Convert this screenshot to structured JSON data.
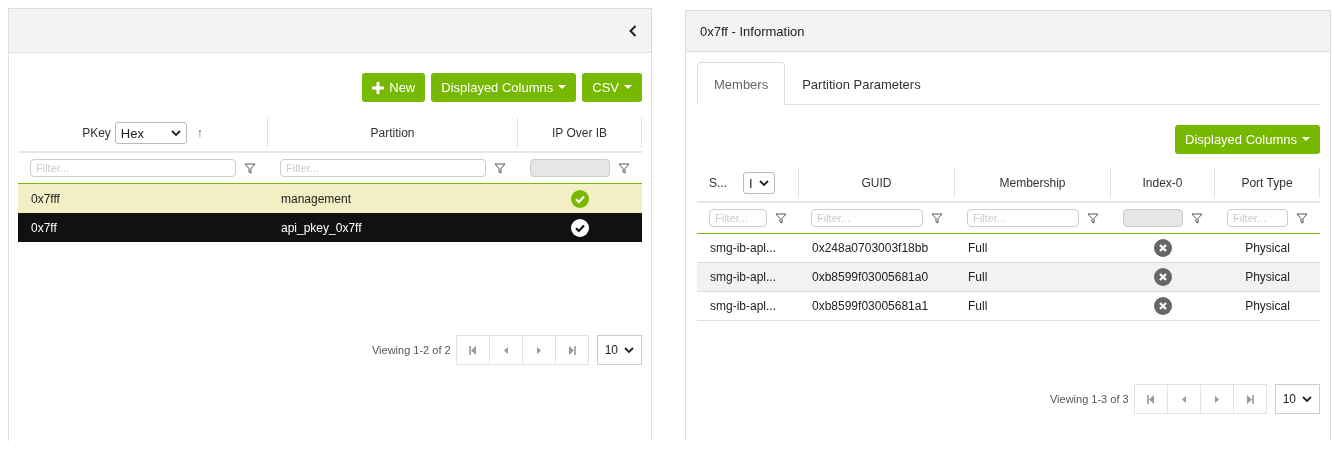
{
  "left_panel": {
    "toolbar": [
      {
        "kind": "new",
        "label": "New"
      },
      {
        "kind": "dropdown",
        "label": "Displayed Columns"
      },
      {
        "kind": "dropdown",
        "label": "CSV"
      }
    ],
    "table": {
      "columns": [
        {
          "label": "PKey",
          "select": "Hex",
          "sort": "↑",
          "filter": {
            "kind": "text",
            "placeholder": "Filter..."
          }
        },
        {
          "label": "Partition",
          "filter": {
            "kind": "text",
            "placeholder": "Filter..."
          }
        },
        {
          "label": "IP Over IB",
          "filter": {
            "kind": "select"
          }
        }
      ],
      "rows": [
        {
          "pkey": "0x7fff",
          "partition": "management",
          "ip_over_ib": true,
          "highlighted": true,
          "selected": false
        },
        {
          "pkey": "0x7ff",
          "partition": "api_pkey_0x7ff",
          "ip_over_ib": true,
          "highlighted": false,
          "selected": true
        }
      ]
    },
    "pagination": {
      "summary": "Viewing 1-2 of 2",
      "page_size": "10"
    }
  },
  "right_panel": {
    "title": "0x7ff - Information",
    "tabs": [
      {
        "label": "Members",
        "selected": true
      },
      {
        "label": "Partition Parameters",
        "selected": false
      }
    ],
    "toolbar": [
      {
        "kind": "dropdown",
        "label": "Displayed Columns"
      }
    ],
    "table": {
      "columns": [
        {
          "label": "S...",
          "select": "I",
          "filter": {
            "kind": "text",
            "placeholder": "Filter..."
          }
        },
        {
          "label": "GUID",
          "filter": {
            "kind": "text",
            "placeholder": "Filter..."
          }
        },
        {
          "label": "Membership",
          "filter": {
            "kind": "text",
            "placeholder": "Filter..."
          }
        },
        {
          "label": "Index-0",
          "filter": {
            "kind": "select"
          }
        },
        {
          "label": "Port Type",
          "filter": {
            "kind": "text",
            "placeholder": "Filter..."
          }
        }
      ],
      "rows": [
        {
          "system": "smg-ib-apl...",
          "guid": "0x248a0703003f18bb",
          "membership": "Full",
          "index_0": false,
          "port_type": "Physical"
        },
        {
          "system": "smg-ib-apl...",
          "guid": "0xb8599f03005681a0",
          "membership": "Full",
          "index_0": false,
          "port_type": "Physical"
        },
        {
          "system": "smg-ib-apl...",
          "guid": "0xb8599f03005681a1",
          "membership": "Full",
          "index_0": false,
          "port_type": "Physical"
        }
      ]
    },
    "pagination": {
      "summary": "Viewing 1-3 of 3",
      "page_size": "10"
    }
  }
}
